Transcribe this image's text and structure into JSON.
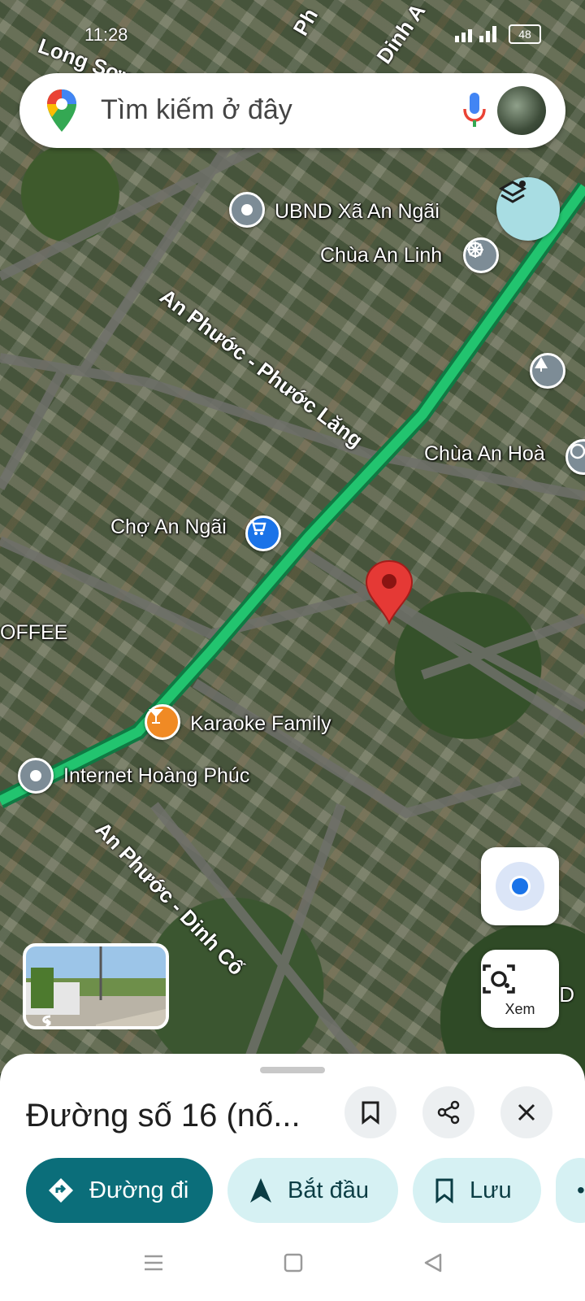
{
  "status_bar": {
    "time": "11:28",
    "battery": "48"
  },
  "search": {
    "placeholder": "Tìm kiếm ở đây"
  },
  "map": {
    "places": [
      {
        "name": "UBND Xã An Ngãi"
      },
      {
        "name": "Chùa An Linh"
      },
      {
        "name": "Chùa An Hoà"
      },
      {
        "name": "Chợ An Ngãi"
      },
      {
        "name": "OFFEE"
      },
      {
        "name": "Karaoke Family"
      },
      {
        "name": "Internet Hoàng Phúc"
      }
    ],
    "roads": [
      {
        "name": "An Phước - Phước Lăng"
      },
      {
        "name": "An Phước - Dinh Cố"
      },
      {
        "name": "Long Sơn"
      },
      {
        "name": "Dinh A"
      },
      {
        "name": "Ph"
      },
      {
        "name": "y D"
      }
    ]
  },
  "controls": {
    "lens_label": "Xem"
  },
  "sheet": {
    "title": "Đường số 16 (nố...",
    "chips": {
      "directions": "Đường đi",
      "start": "Bắt đầu",
      "save": "Lưu"
    }
  },
  "colors": {
    "accent": "#0b6e7a",
    "chip_light": "#d6f1f3",
    "route": "#1db56a",
    "pin": "#e53935"
  }
}
